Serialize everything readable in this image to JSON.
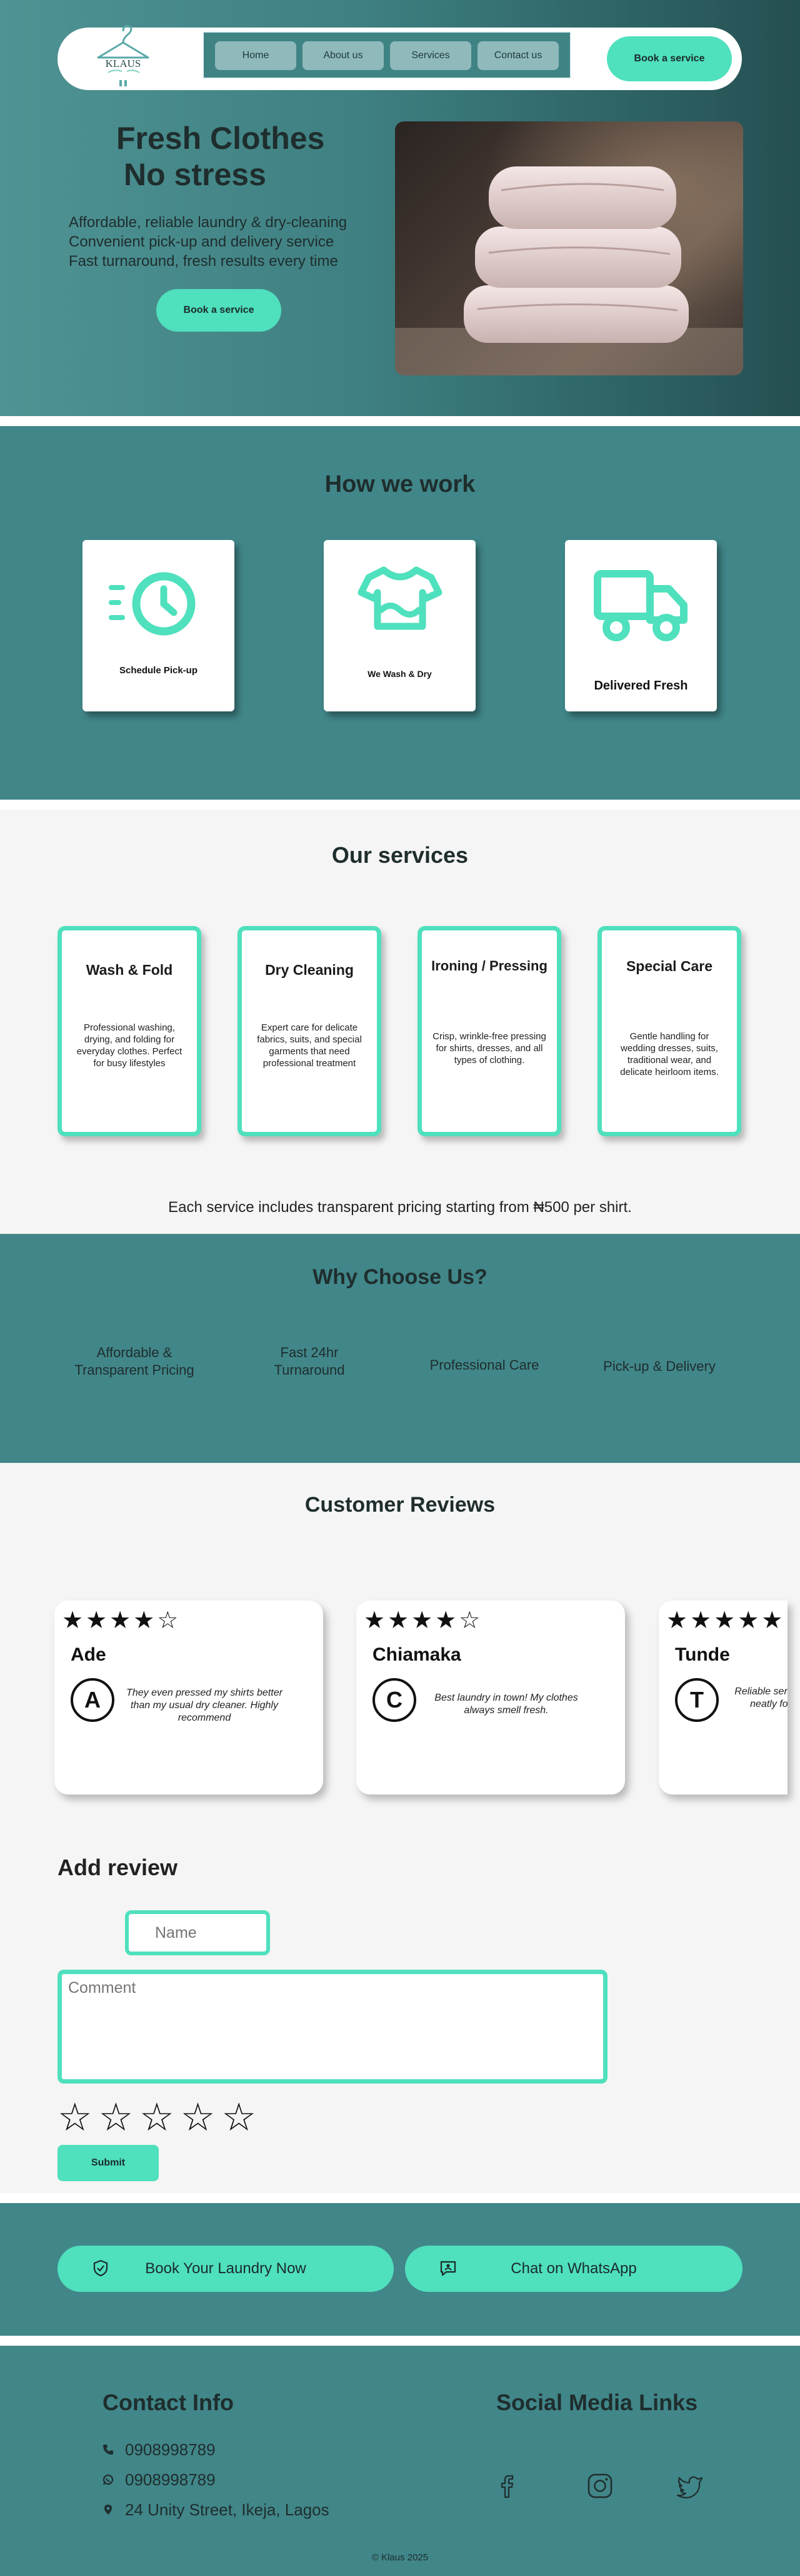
{
  "header": {
    "logo_text": "KLAUS",
    "nav": [
      "Home",
      "About us",
      "Services",
      "Contact us"
    ],
    "book_button": "Book a service"
  },
  "hero": {
    "title_line1": "Fresh Clothes",
    "title_line2": "No stress",
    "lines": [
      "Affordable, reliable laundry & dry-cleaning",
      "Convenient pick-up and delivery service",
      "Fast turnaround, fresh results every time"
    ],
    "cta": "Book a service"
  },
  "how": {
    "title": "How we work",
    "steps": [
      "Schedule Pick-up",
      "We Wash & Dry",
      "Delivered Fresh"
    ]
  },
  "services": {
    "title": "Our services",
    "items": [
      {
        "title": "Wash & Fold",
        "desc": "Professional washing, drying, and folding for everyday clothes. Perfect for busy lifestyles"
      },
      {
        "title": "Dry Cleaning",
        "desc": "Expert care for delicate fabrics, suits, and special garments that need professional treatment"
      },
      {
        "title": "Ironing / Pressing",
        "desc": "Crisp, wrinkle-free pressing for shirts, dresses, and all types of clothing."
      },
      {
        "title": "Special Care",
        "desc": "Gentle handling for wedding dresses, suits, traditional wear, and delicate heirloom items."
      }
    ],
    "note": "Each service includes transparent pricing starting from ₦500 per shirt."
  },
  "why": {
    "title": "Why Choose Us?",
    "items": [
      {
        "l1": "Affordable &",
        "l2": "Transparent Pricing"
      },
      {
        "l1": "Fast 24hr",
        "l2": "Turnaround"
      },
      {
        "l1": "Professional Care",
        "l2": ""
      },
      {
        "l1": "Pick-up & Delivery",
        "l2": ""
      }
    ]
  },
  "reviews": {
    "title": "Customer Reviews",
    "cards": [
      {
        "stars": "★★★★☆",
        "name": "Ade",
        "initial": "A",
        "quote": "They even pressed my shirts better than my usual dry cleaner. Highly recommend"
      },
      {
        "stars": "★★★★☆",
        "name": "Chiamaka",
        "initial": "C",
        "quote": "Best laundry in town! My clothes always smell fresh."
      },
      {
        "stars": "★★★★★",
        "name": "Tunde",
        "initial": "T",
        "quote": "Reliable service, on time. Clothes neatly folded and pressed."
      }
    ],
    "add_title": "Add review",
    "name_placeholder": "Name",
    "comment_placeholder": "Comment",
    "rating_stars": "☆☆☆☆☆",
    "submit": "Submit"
  },
  "cta": {
    "book": "Book Your Laundry Now",
    "whatsapp": "Chat on WhatsApp"
  },
  "footer": {
    "contact_title": "Contact Info",
    "phone1": "0908998789",
    "phone2": "0908998789",
    "address": "24 Unity Street, Ikeja, Lagos",
    "social_title": "Social Media Links",
    "copyright": "© Klaus 2025"
  },
  "colors": {
    "teal": "#418689",
    "mint": "#4fe0bd",
    "light_bg": "#f5f5f5"
  }
}
